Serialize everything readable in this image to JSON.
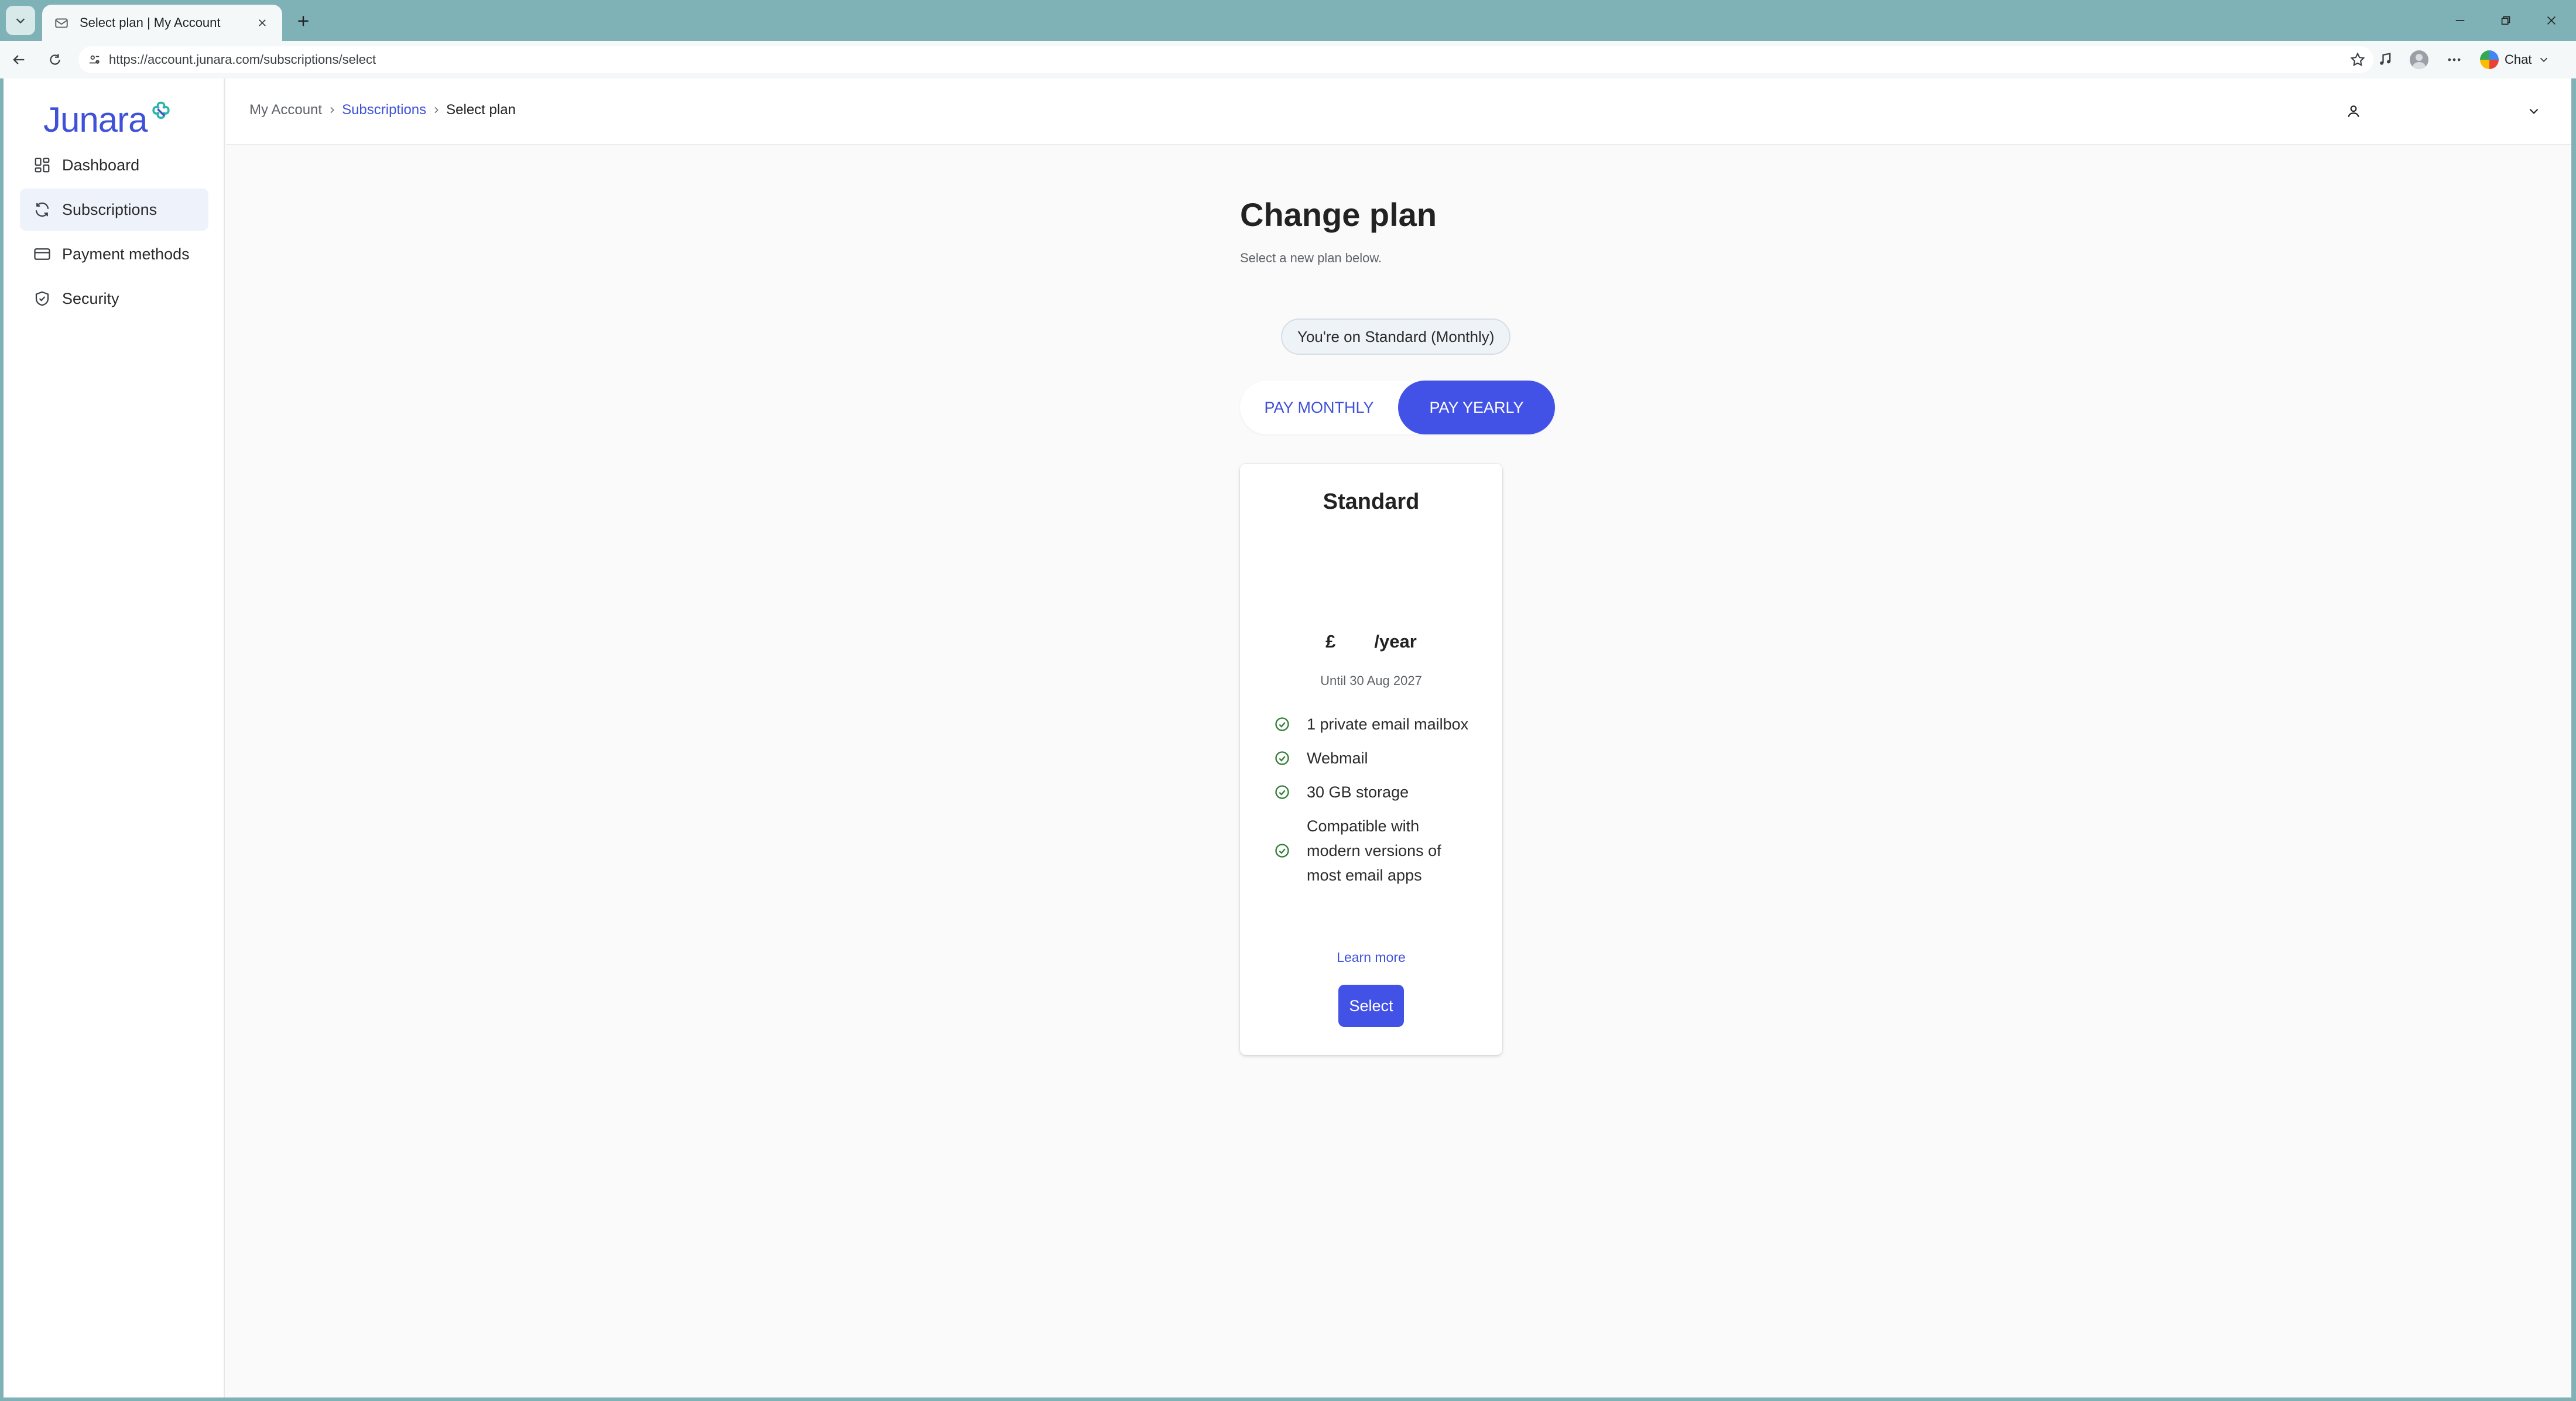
{
  "browser": {
    "tab_title": "Select plan | My Account",
    "url": "https://account.junara.com/subscriptions/select",
    "chat_label": "Chat"
  },
  "brand": {
    "logo_text": "Junara",
    "accent_color": "#4352e6",
    "link_color": "#3f51d9",
    "success_color": "#2e7d32"
  },
  "sidebar": {
    "items": [
      {
        "label": "Dashboard",
        "icon": "grid-icon",
        "active": false
      },
      {
        "label": "Subscriptions",
        "icon": "refresh-icon",
        "active": true
      },
      {
        "label": "Payment methods",
        "icon": "credit-card-icon",
        "active": false
      },
      {
        "label": "Security",
        "icon": "shield-check-icon",
        "active": false
      }
    ]
  },
  "breadcrumb": {
    "items": [
      "My Account",
      "Subscriptions",
      "Select plan"
    ]
  },
  "page": {
    "title": "Change plan",
    "subtitle": "Select a new plan below.",
    "current_plan": "You're on Standard (Monthly)"
  },
  "billing": {
    "monthly_label": "PAY MONTHLY",
    "yearly_label": "PAY YEARLY",
    "selected": "yearly"
  },
  "plan": {
    "name": "Standard",
    "currency": "£",
    "period": "/year",
    "until": "Until 30 Aug 2027",
    "features": [
      "1 private email mailbox",
      "Webmail",
      "30 GB storage",
      "Compatible with modern versions of most email apps"
    ],
    "learn_more": "Learn more",
    "select_label": "Select"
  }
}
